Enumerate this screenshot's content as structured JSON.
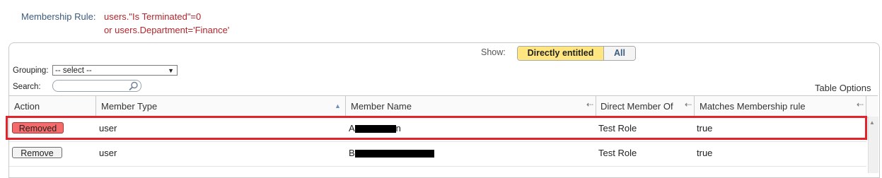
{
  "membership_rule": {
    "label": "Membership Rule:",
    "line1": "users.\"Is Terminated\"=0",
    "line2": "or users.Department='Finance'"
  },
  "show": {
    "label": "Show:",
    "options": [
      "Directly entitled",
      "All"
    ],
    "active": "Directly entitled"
  },
  "grouping": {
    "label": "Grouping:",
    "selected": "-- select --"
  },
  "search": {
    "label": "Search:",
    "value": ""
  },
  "table_options_label": "Table Options",
  "table": {
    "columns": [
      "Action",
      "Member Type",
      "Member Name",
      "Direct Member Of",
      "Matches Membership rule"
    ],
    "rows": [
      {
        "action": "Removed",
        "member_type": "user",
        "member_name_prefix": "A",
        "member_name_suffix": "n",
        "direct_member_of": "Test Role",
        "matches": "true",
        "highlighted": true
      },
      {
        "action": "Remove",
        "member_type": "user",
        "member_name_prefix": "B",
        "member_name_suffix": "",
        "direct_member_of": "Test Role",
        "matches": "true",
        "highlighted": false
      }
    ]
  },
  "colors": {
    "rule_label": "#3b5b7f",
    "rule_text": "#b3262b",
    "active_toggle": "#ffe680",
    "removed_button": "#f56a6a",
    "highlight_border": "#e2232c"
  }
}
